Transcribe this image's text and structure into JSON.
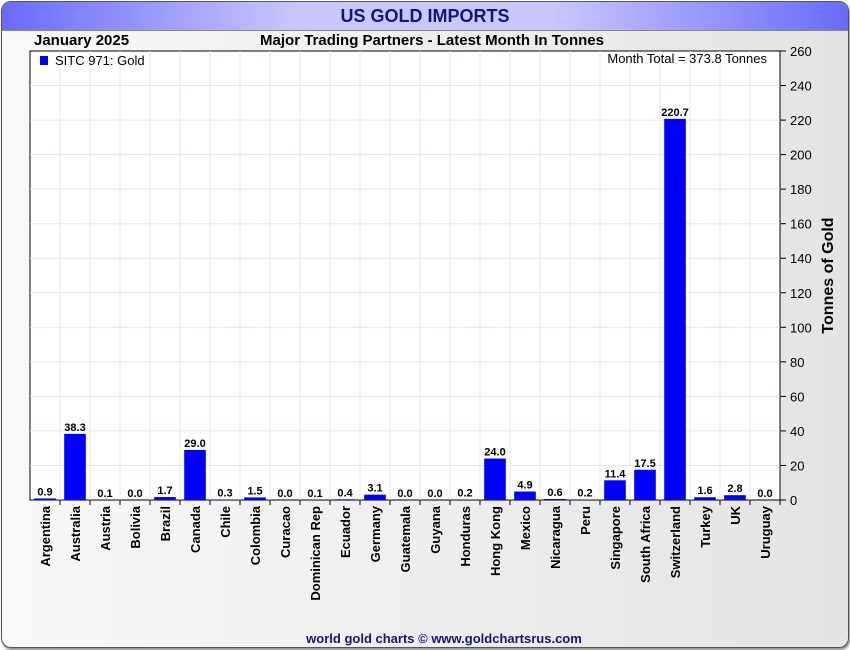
{
  "title": "US GOLD IMPORTS",
  "footer": "world gold charts © www.goldchartsrus.com",
  "colors": {
    "bar": "#0000ff",
    "title": "#141480"
  },
  "chart_data": {
    "type": "bar",
    "date_label": "January 2025",
    "title": "Major Trading Partners - Latest Month In Tonnes",
    "legend": "SITC 971: Gold",
    "legend_position": "top-left",
    "annotation": "Month Total = 373.8 Tonnes",
    "ylabel": "Tonnes of Gold",
    "ylim": [
      0,
      260
    ],
    "yticks": [
      0,
      20,
      40,
      60,
      80,
      100,
      120,
      140,
      160,
      180,
      200,
      220,
      240,
      260
    ],
    "grid": true,
    "categories": [
      "Argentina",
      "Australia",
      "Austria",
      "Bolivia",
      "Brazil",
      "Canada",
      "Chile",
      "Colombia",
      "Curacao",
      "Dominican Rep",
      "Ecuador",
      "Germany",
      "Guatemala",
      "Guyana",
      "Honduras",
      "Hong Kong",
      "Mexico",
      "Nicaragua",
      "Peru",
      "Singapore",
      "South Africa",
      "Switzerland",
      "Turkey",
      "UK",
      "Uruguay"
    ],
    "values": [
      0.9,
      38.3,
      0.1,
      0.0,
      1.7,
      29.0,
      0.3,
      1.5,
      0.0,
      0.1,
      0.4,
      3.1,
      0.0,
      0.0,
      0.2,
      24.0,
      4.9,
      0.6,
      0.2,
      11.4,
      17.5,
      220.7,
      1.6,
      2.8,
      0.0
    ]
  }
}
